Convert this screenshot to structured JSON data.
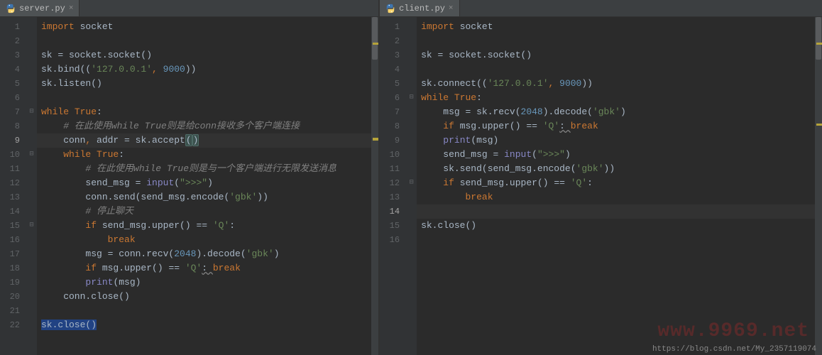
{
  "left": {
    "tab": {
      "filename": "server.py"
    },
    "cursor_line": 9,
    "lines": [
      {
        "n": 1,
        "tokens": [
          {
            "t": "import ",
            "c": "kw"
          },
          {
            "t": "socket"
          }
        ]
      },
      {
        "n": 2,
        "tokens": []
      },
      {
        "n": 3,
        "tokens": [
          {
            "t": "sk = socket.socket()"
          }
        ]
      },
      {
        "n": 4,
        "tokens": [
          {
            "t": "sk.bind(("
          },
          {
            "t": "'127.0.0.1'",
            "c": "str"
          },
          {
            "t": ", ",
            "c": "kw"
          },
          {
            "t": "9000",
            "c": "num"
          },
          {
            "t": "))"
          }
        ]
      },
      {
        "n": 5,
        "tokens": [
          {
            "t": "sk.listen()"
          }
        ]
      },
      {
        "n": 6,
        "tokens": []
      },
      {
        "n": 7,
        "tokens": [
          {
            "t": "while ",
            "c": "kw"
          },
          {
            "t": "True",
            "c": "kw"
          },
          {
            "t": ":"
          }
        ]
      },
      {
        "n": 8,
        "tokens": [
          {
            "t": "    "
          },
          {
            "t": "# 在此使用while True则是给conn接收多个客户端连接",
            "c": "com"
          }
        ]
      },
      {
        "n": 9,
        "tokens": [
          {
            "t": "    conn"
          },
          {
            "t": ", ",
            "c": "kw"
          },
          {
            "t": "addr = sk.accept"
          },
          {
            "t": "(",
            "c": "paren-hl"
          },
          {
            "t": ")",
            "c": "paren-hl"
          }
        ]
      },
      {
        "n": 10,
        "tokens": [
          {
            "t": "    "
          },
          {
            "t": "while ",
            "c": "kw"
          },
          {
            "t": "True",
            "c": "kw"
          },
          {
            "t": ":"
          }
        ]
      },
      {
        "n": 11,
        "tokens": [
          {
            "t": "        "
          },
          {
            "t": "# 在此使用while True则是与一个客户端进行无限发送消息",
            "c": "com"
          }
        ]
      },
      {
        "n": 12,
        "tokens": [
          {
            "t": "        send_msg = "
          },
          {
            "t": "input",
            "c": "builtin"
          },
          {
            "t": "("
          },
          {
            "t": "\">>>\"",
            "c": "str"
          },
          {
            "t": ")"
          }
        ]
      },
      {
        "n": 13,
        "tokens": [
          {
            "t": "        conn.send(send_msg.encode("
          },
          {
            "t": "'gbk'",
            "c": "str"
          },
          {
            "t": "))"
          }
        ]
      },
      {
        "n": 14,
        "tokens": [
          {
            "t": "        "
          },
          {
            "t": "# 停止聊天",
            "c": "com"
          }
        ]
      },
      {
        "n": 15,
        "tokens": [
          {
            "t": "        "
          },
          {
            "t": "if ",
            "c": "kw"
          },
          {
            "t": "send_msg.upper() == "
          },
          {
            "t": "'Q'",
            "c": "str"
          },
          {
            "t": ":"
          }
        ]
      },
      {
        "n": 16,
        "tokens": [
          {
            "t": "            "
          },
          {
            "t": "break",
            "c": "kw"
          }
        ]
      },
      {
        "n": 17,
        "tokens": [
          {
            "t": "        msg = conn.recv("
          },
          {
            "t": "2048",
            "c": "num"
          },
          {
            "t": ").decode("
          },
          {
            "t": "'gbk'",
            "c": "str"
          },
          {
            "t": ")"
          }
        ]
      },
      {
        "n": 18,
        "tokens": [
          {
            "t": "        "
          },
          {
            "t": "if ",
            "c": "kw"
          },
          {
            "t": "msg.upper() == "
          },
          {
            "t": "'Q'",
            "c": "str"
          },
          {
            "t": ": ",
            "c": "semi-u"
          },
          {
            "t": "break",
            "c": "kw"
          }
        ]
      },
      {
        "n": 19,
        "tokens": [
          {
            "t": "        "
          },
          {
            "t": "print",
            "c": "builtin"
          },
          {
            "t": "(msg)"
          }
        ]
      },
      {
        "n": 20,
        "tokens": [
          {
            "t": "    conn.close()"
          }
        ]
      },
      {
        "n": 21,
        "tokens": []
      },
      {
        "n": 22,
        "tokens": [
          {
            "t": "sk.close()",
            "c": "sel"
          }
        ]
      }
    ]
  },
  "right": {
    "tab": {
      "filename": "client.py"
    },
    "cursor_line": 14,
    "lines": [
      {
        "n": 1,
        "tokens": [
          {
            "t": "import ",
            "c": "kw"
          },
          {
            "t": "socket"
          }
        ]
      },
      {
        "n": 2,
        "tokens": []
      },
      {
        "n": 3,
        "tokens": [
          {
            "t": "sk = socket.socket()"
          }
        ]
      },
      {
        "n": 4,
        "tokens": []
      },
      {
        "n": 5,
        "tokens": [
          {
            "t": "sk.connect(("
          },
          {
            "t": "'127.0.0.1'",
            "c": "str"
          },
          {
            "t": ", ",
            "c": "kw"
          },
          {
            "t": "9000",
            "c": "num"
          },
          {
            "t": "))"
          }
        ]
      },
      {
        "n": 6,
        "tokens": [
          {
            "t": "while ",
            "c": "kw"
          },
          {
            "t": "True",
            "c": "kw"
          },
          {
            "t": ":"
          }
        ]
      },
      {
        "n": 7,
        "tokens": [
          {
            "t": "    msg = sk.recv("
          },
          {
            "t": "2048",
            "c": "num"
          },
          {
            "t": ").decode("
          },
          {
            "t": "'gbk'",
            "c": "str"
          },
          {
            "t": ")"
          }
        ]
      },
      {
        "n": 8,
        "tokens": [
          {
            "t": "    "
          },
          {
            "t": "if ",
            "c": "kw"
          },
          {
            "t": "msg.upper() == "
          },
          {
            "t": "'Q'",
            "c": "str"
          },
          {
            "t": ": ",
            "c": "semi-u"
          },
          {
            "t": "break",
            "c": "kw"
          }
        ]
      },
      {
        "n": 9,
        "tokens": [
          {
            "t": "    "
          },
          {
            "t": "print",
            "c": "builtin"
          },
          {
            "t": "(msg)"
          }
        ]
      },
      {
        "n": 10,
        "tokens": [
          {
            "t": "    send_msg = "
          },
          {
            "t": "input",
            "c": "builtin"
          },
          {
            "t": "("
          },
          {
            "t": "\">>>\"",
            "c": "str"
          },
          {
            "t": ")"
          }
        ]
      },
      {
        "n": 11,
        "tokens": [
          {
            "t": "    sk.send(send_msg.encode("
          },
          {
            "t": "'gbk'",
            "c": "str"
          },
          {
            "t": "))"
          }
        ]
      },
      {
        "n": 12,
        "tokens": [
          {
            "t": "    "
          },
          {
            "t": "if ",
            "c": "kw"
          },
          {
            "t": "send_msg.upper() == "
          },
          {
            "t": "'Q'",
            "c": "str"
          },
          {
            "t": ":"
          }
        ]
      },
      {
        "n": 13,
        "tokens": [
          {
            "t": "        "
          },
          {
            "t": "break",
            "c": "kw"
          }
        ]
      },
      {
        "n": 14,
        "tokens": []
      },
      {
        "n": 15,
        "tokens": [
          {
            "t": "sk.close()"
          }
        ]
      },
      {
        "n": 16,
        "tokens": []
      }
    ]
  },
  "footer_url": "https://blog.csdn.net/My_2357119074",
  "watermark": "www.9969.net"
}
